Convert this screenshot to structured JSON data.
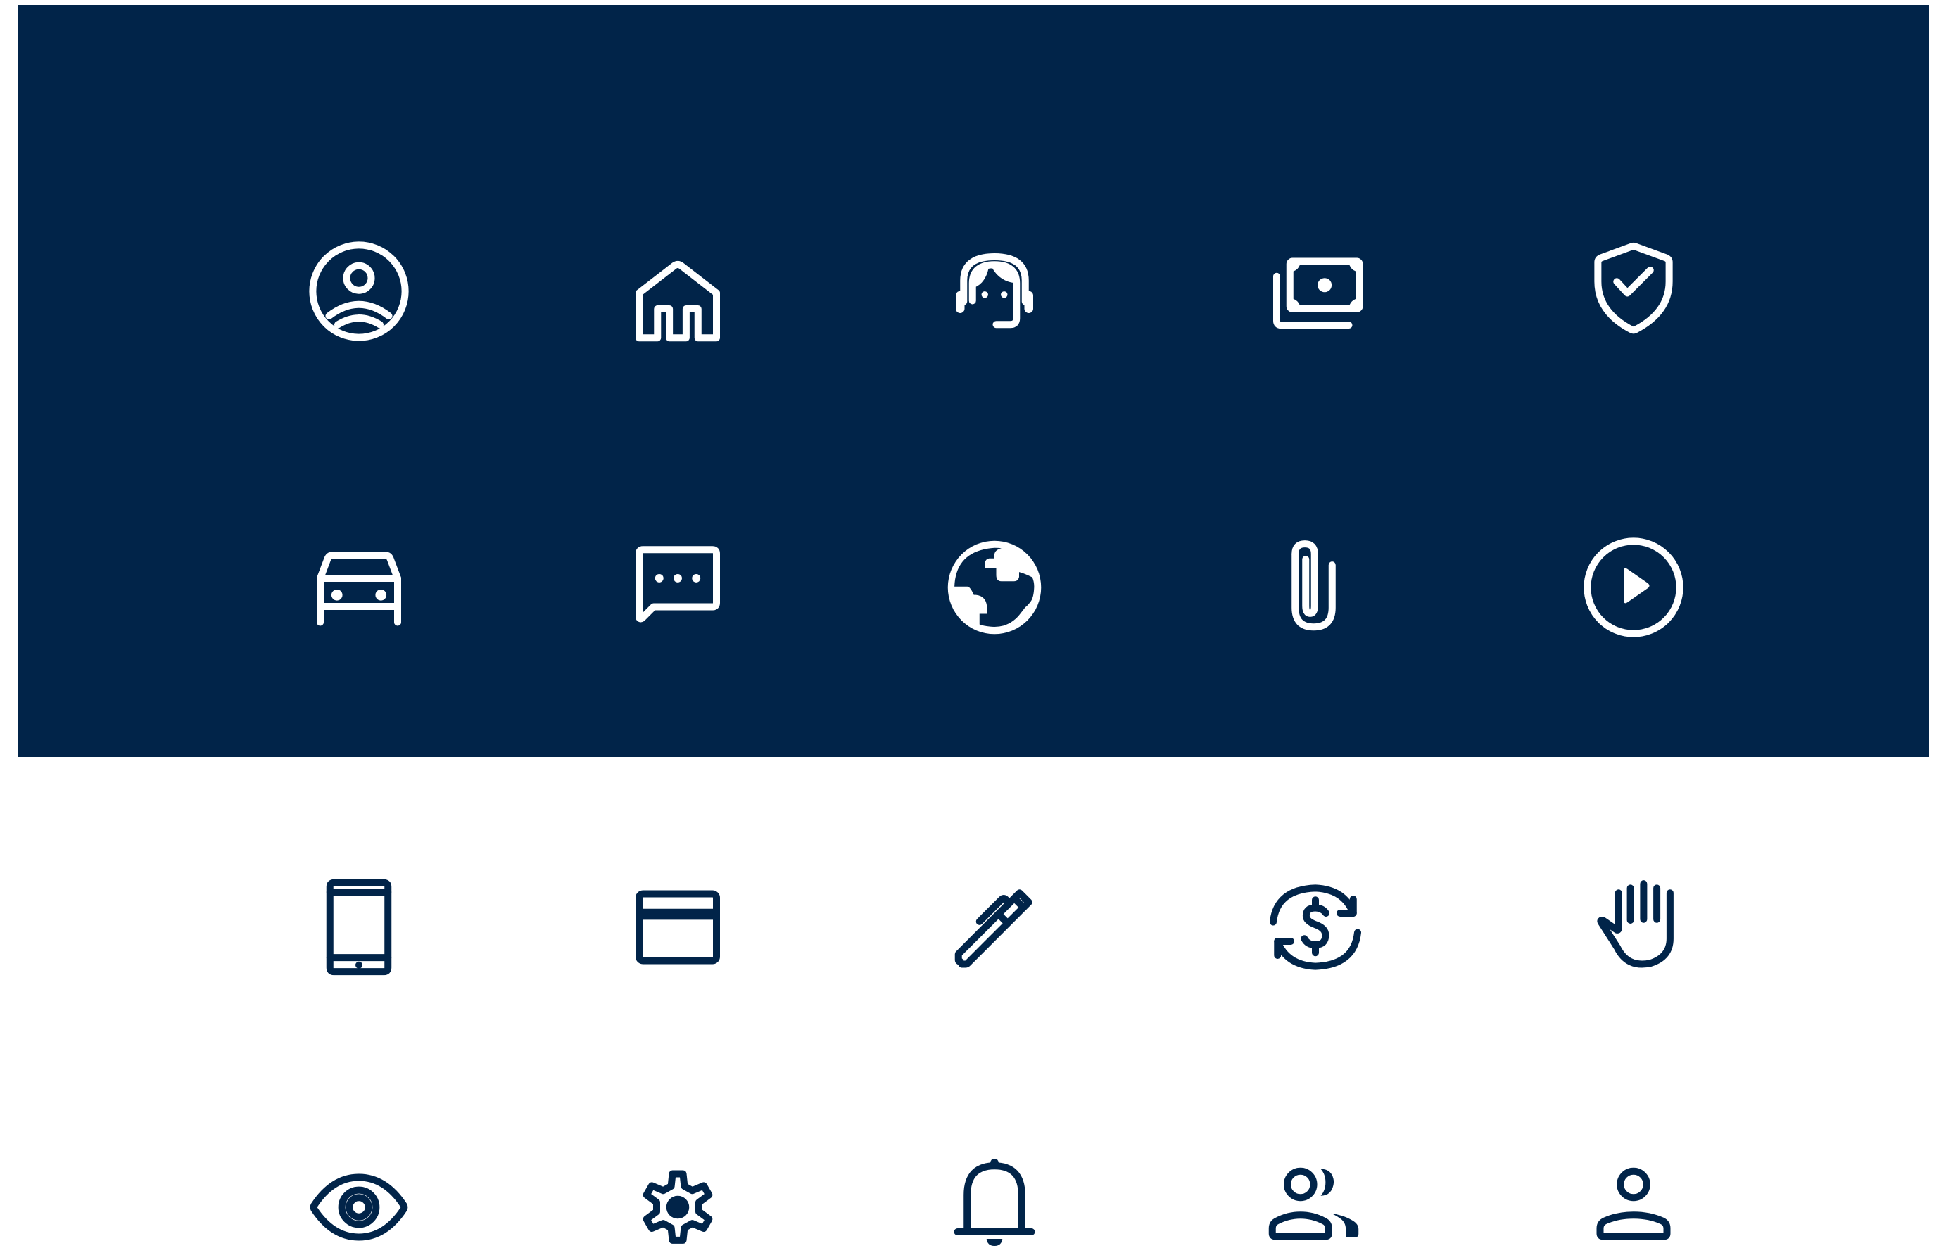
{
  "colors": {
    "panel_background": "#012449",
    "page_background": "#ffffff",
    "light_icon": "#ffffff",
    "dark_icon": "#012449"
  },
  "icon_rows": [
    {
      "theme": "light",
      "icons": [
        "user-circle-icon",
        "home-icon",
        "customer-support-icon",
        "cash-icon",
        "shield-check-icon"
      ]
    },
    {
      "theme": "light",
      "icons": [
        "car-icon",
        "chat-bubble-icon",
        "globe-icon",
        "paperclip-icon",
        "play-circle-icon"
      ]
    },
    {
      "theme": "dark",
      "icons": [
        "mobile-phone-icon",
        "credit-card-icon",
        "pen-icon",
        "dollar-refresh-icon",
        "raised-hand-icon"
      ]
    },
    {
      "theme": "dark",
      "icons": [
        "eye-icon",
        "settings-gear-icon",
        "notification-bell-icon",
        "users-group-icon",
        "user-icon"
      ]
    }
  ]
}
